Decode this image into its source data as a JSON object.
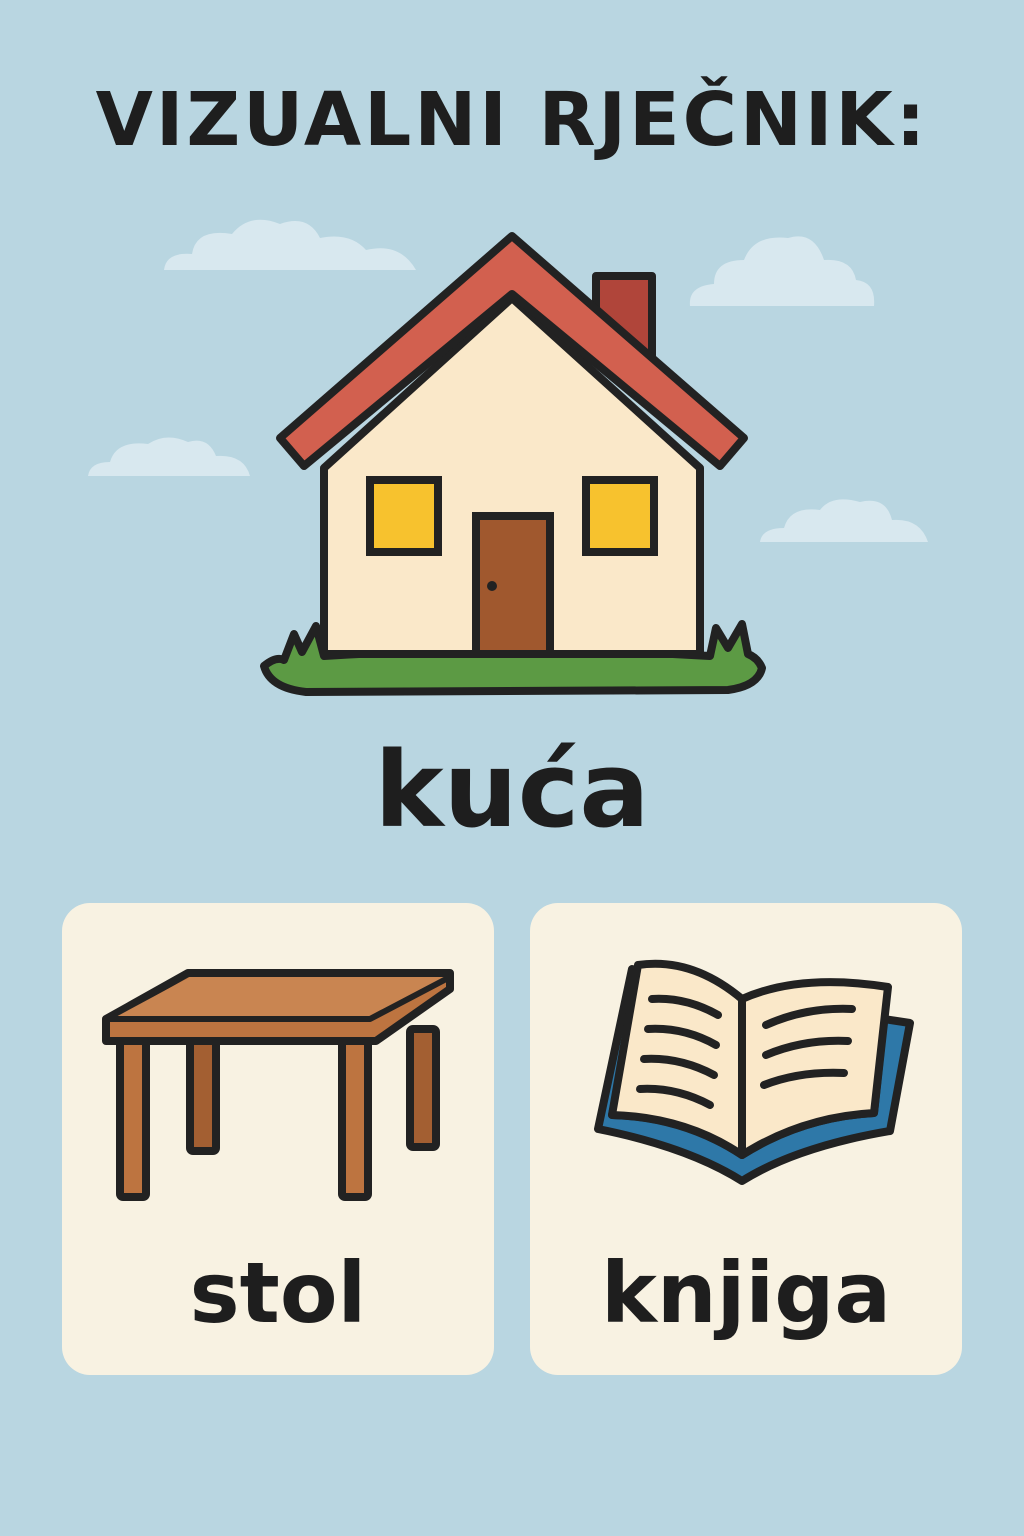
{
  "title": "VIZUALNI RJEČNIK:",
  "main_entry": {
    "word": "kuća",
    "icon": "house-icon"
  },
  "cards": [
    {
      "word": "stol",
      "icon": "table-icon"
    },
    {
      "word": "knjiga",
      "icon": "book-icon"
    }
  ],
  "colors": {
    "background": "#b9d6e1",
    "card": "#f8f2e2",
    "text": "#1e1e1e",
    "roof": "#d2604f",
    "wall": "#fae8c9",
    "window": "#f7c22e",
    "door": "#a0582e",
    "grass": "#5c9a44",
    "table_wood": "#bd7440",
    "book_cover": "#2e78a8"
  }
}
